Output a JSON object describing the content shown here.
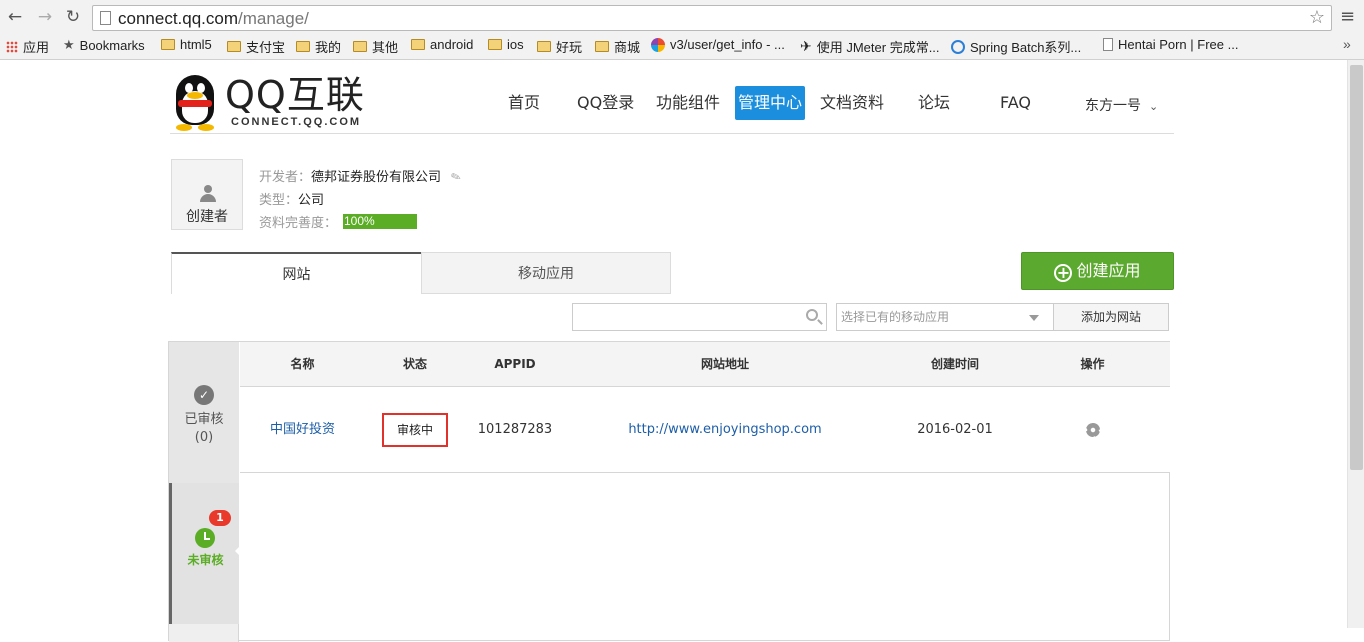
{
  "browser": {
    "url_host": "connect.qq.com",
    "url_path": "/manage/",
    "bookmarks": [
      {
        "label": "应用",
        "icon": "apps-grid-icon"
      },
      {
        "label": "Bookmarks",
        "icon": "star-icon"
      },
      {
        "label": "html5",
        "icon": "folder-icon"
      },
      {
        "label": "支付宝",
        "icon": "folder-icon"
      },
      {
        "label": "我的",
        "icon": "folder-icon"
      },
      {
        "label": "其他",
        "icon": "folder-icon"
      },
      {
        "label": "android",
        "icon": "folder-icon"
      },
      {
        "label": "ios",
        "icon": "folder-icon"
      },
      {
        "label": "好玩",
        "icon": "folder-icon"
      },
      {
        "label": "商城",
        "icon": "folder-icon"
      },
      {
        "label": "v3/user/get_info - ...",
        "icon": "site-favicon"
      },
      {
        "label": "使用 JMeter 完成常...",
        "icon": "site-favicon"
      },
      {
        "label": "Spring Batch系列...",
        "icon": "site-favicon"
      },
      {
        "label": "Hentai Porn | Free ...",
        "icon": "page-icon"
      }
    ],
    "more": "»"
  },
  "header": {
    "logo_text": "QQ互联",
    "logo_sub": "CONNECT.QQ.COM",
    "nav": [
      "首页",
      "QQ登录",
      "功能组件",
      "管理中心",
      "文档资料",
      "论坛",
      "FAQ"
    ],
    "active_nav": "管理中心",
    "user_name": "东方一号"
  },
  "developer": {
    "avatar_label": "创建者",
    "developer_key": "开发者：",
    "developer_value": "德邦证券股份有限公司",
    "type_key": "类型：",
    "type_value": "公司",
    "completeness_key": "资料完善度：",
    "completeness_value": "100%",
    "completeness_fraction": 1.0
  },
  "tabs": {
    "website": "网站",
    "mobile": "移动应用",
    "create_button": "创建应用"
  },
  "filters": {
    "search_placeholder": "",
    "select_placeholder": "选择已有的移动应用",
    "add_button": "添加为网站"
  },
  "sidebar": {
    "reviewed_label": "已审核",
    "reviewed_count": "(0)",
    "pending_label": "未审核",
    "pending_badge": "1"
  },
  "table": {
    "columns": [
      "名称",
      "状态",
      "APPID",
      "网站地址",
      "创建时间",
      "操作"
    ],
    "rows": [
      {
        "name": "中国好投资",
        "status": "审核中",
        "appid": "101287283",
        "url": "http://www.enjoyingshop.com",
        "created": "2016-02-01"
      }
    ]
  },
  "colors": {
    "accent_blue": "#1b8fde",
    "green": "#5ca92f",
    "highlight_red": "#e0312a",
    "link": "#1d5ea8"
  }
}
